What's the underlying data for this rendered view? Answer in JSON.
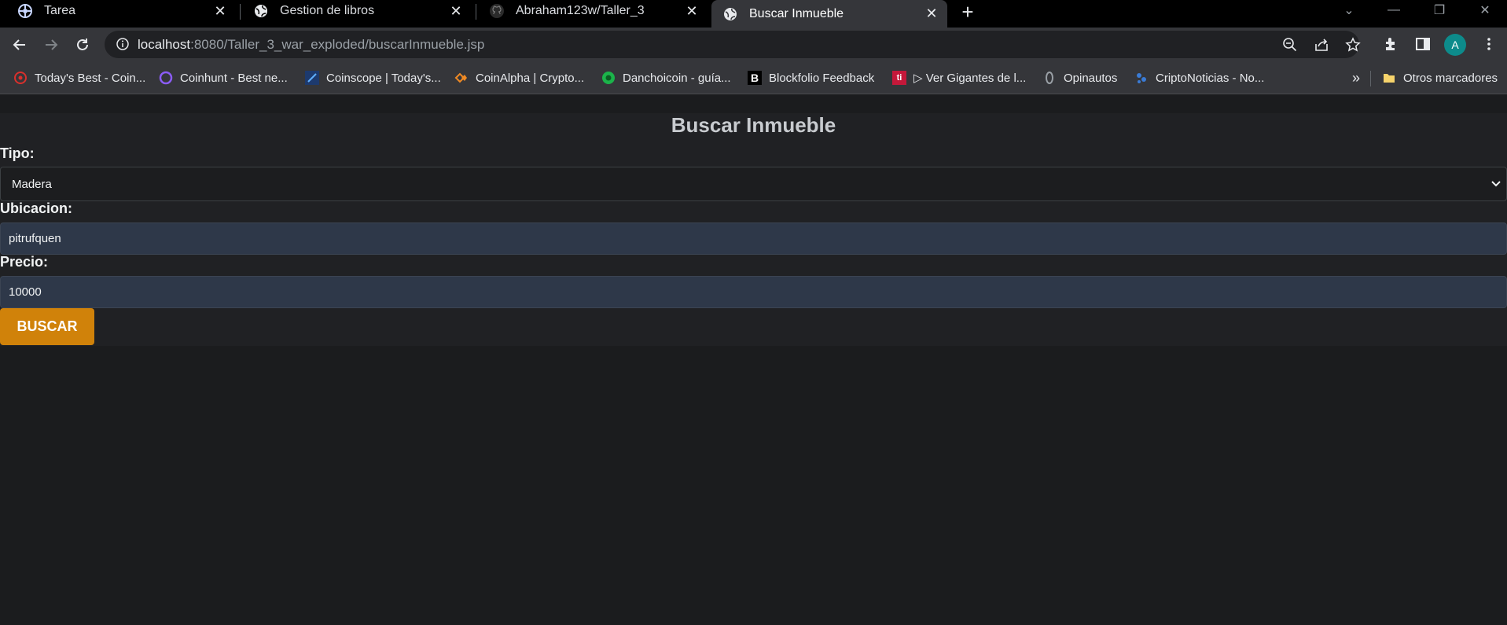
{
  "tabs": [
    {
      "label": "Tarea",
      "icon": "settings-globe-icon"
    },
    {
      "label": "Gestion de libros",
      "icon": "globe-icon"
    },
    {
      "label": "Abraham123w/Taller_3",
      "icon": "github-icon"
    },
    {
      "label": "Buscar Inmueble",
      "icon": "globe-icon",
      "active": true
    }
  ],
  "toolbar": {
    "url_host": "localhost",
    "url_path": ":8080/Taller_3_war_exploded/buscarInmueble.jsp",
    "avatar_letter": "A"
  },
  "bookmarks": [
    {
      "label": "Today's Best - Coin..."
    },
    {
      "label": "Coinhunt - Best ne..."
    },
    {
      "label": "Coinscope | Today's..."
    },
    {
      "label": "CoinAlpha | Crypto..."
    },
    {
      "label": "Danchoicoin - guía..."
    },
    {
      "label": "Blockfolio Feedback"
    },
    {
      "label": "▷ Ver Gigantes de l..."
    },
    {
      "label": "Opinautos"
    },
    {
      "label": "CriptoNoticias - No..."
    }
  ],
  "bookmarks_more": "»",
  "other_bookmarks": "Otros marcadores",
  "form": {
    "title": "Buscar Inmueble",
    "tipo_label": "Tipo:",
    "tipo_value": "Madera",
    "ubicacion_label": "Ubicacion:",
    "ubicacion_value": "pitrufquen",
    "precio_label": "Precio:",
    "precio_value": "10000",
    "submit_label": "BUSCAR"
  },
  "colors": {
    "button": "#d0820a",
    "input_bg": "#2e3849",
    "page_bg": "#1b1c1e",
    "chrome_bg": "#35363a"
  }
}
